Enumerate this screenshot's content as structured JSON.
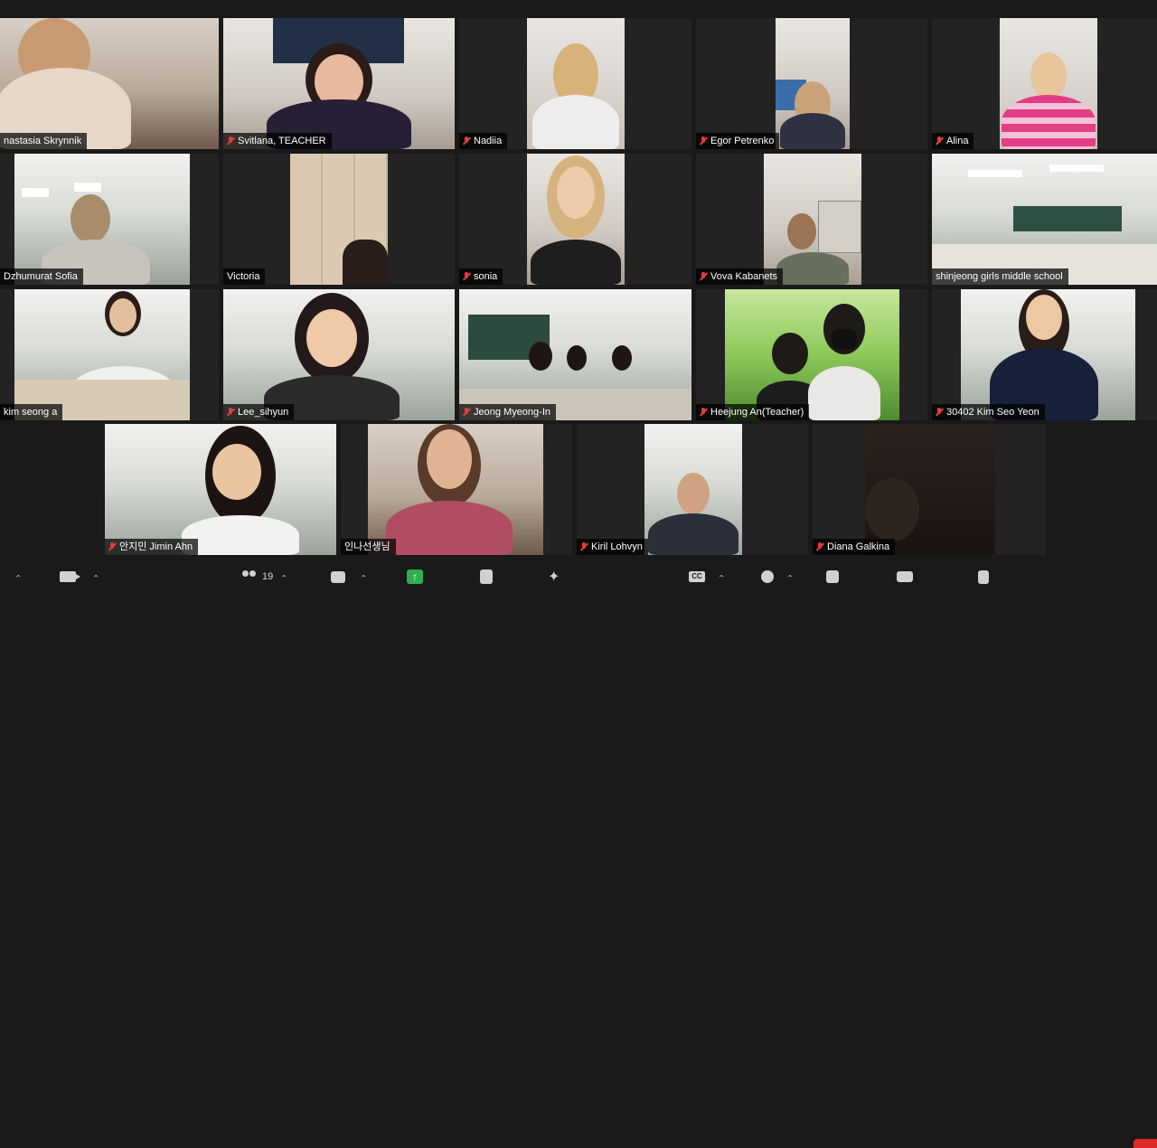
{
  "participants": [
    {
      "name": "nastasia Skrynnik",
      "muted": false
    },
    {
      "name": "Svitlana, TEACHER",
      "muted": true
    },
    {
      "name": "Nadiia",
      "muted": true
    },
    {
      "name": "Egor Petrenko",
      "muted": true
    },
    {
      "name": "Alina",
      "muted": true
    },
    {
      "name": "Dzhumurat Sofia",
      "muted": false
    },
    {
      "name": "Victoria",
      "muted": false
    },
    {
      "name": "sonia",
      "muted": true
    },
    {
      "name": "Vova Kabanets",
      "muted": true
    },
    {
      "name": "shinjeong girls middle school",
      "muted": false
    },
    {
      "name": "kim seong a",
      "muted": false
    },
    {
      "name": "Lee_sihyun",
      "muted": true
    },
    {
      "name": "Jeong Myeong-In",
      "muted": true
    },
    {
      "name": "Heejung An(Teacher)",
      "muted": true
    },
    {
      "name": "30402 Kim Seo Yeon",
      "muted": true
    },
    {
      "name": "안지민 Jimin Ahn",
      "muted": true
    },
    {
      "name": "인나선생님",
      "muted": false
    },
    {
      "name": "Kiril Lohvyn",
      "muted": true
    },
    {
      "name": "Diana Galkina",
      "muted": true
    }
  ],
  "toolbar": {
    "participants_count": "19"
  },
  "colors": {
    "background": "#1a1a1a",
    "tile": "#232323",
    "active_speaker_border": "#c9d97a",
    "muted_mic": "#e33b3b",
    "share": "#2fb050",
    "end": "#e02828"
  }
}
